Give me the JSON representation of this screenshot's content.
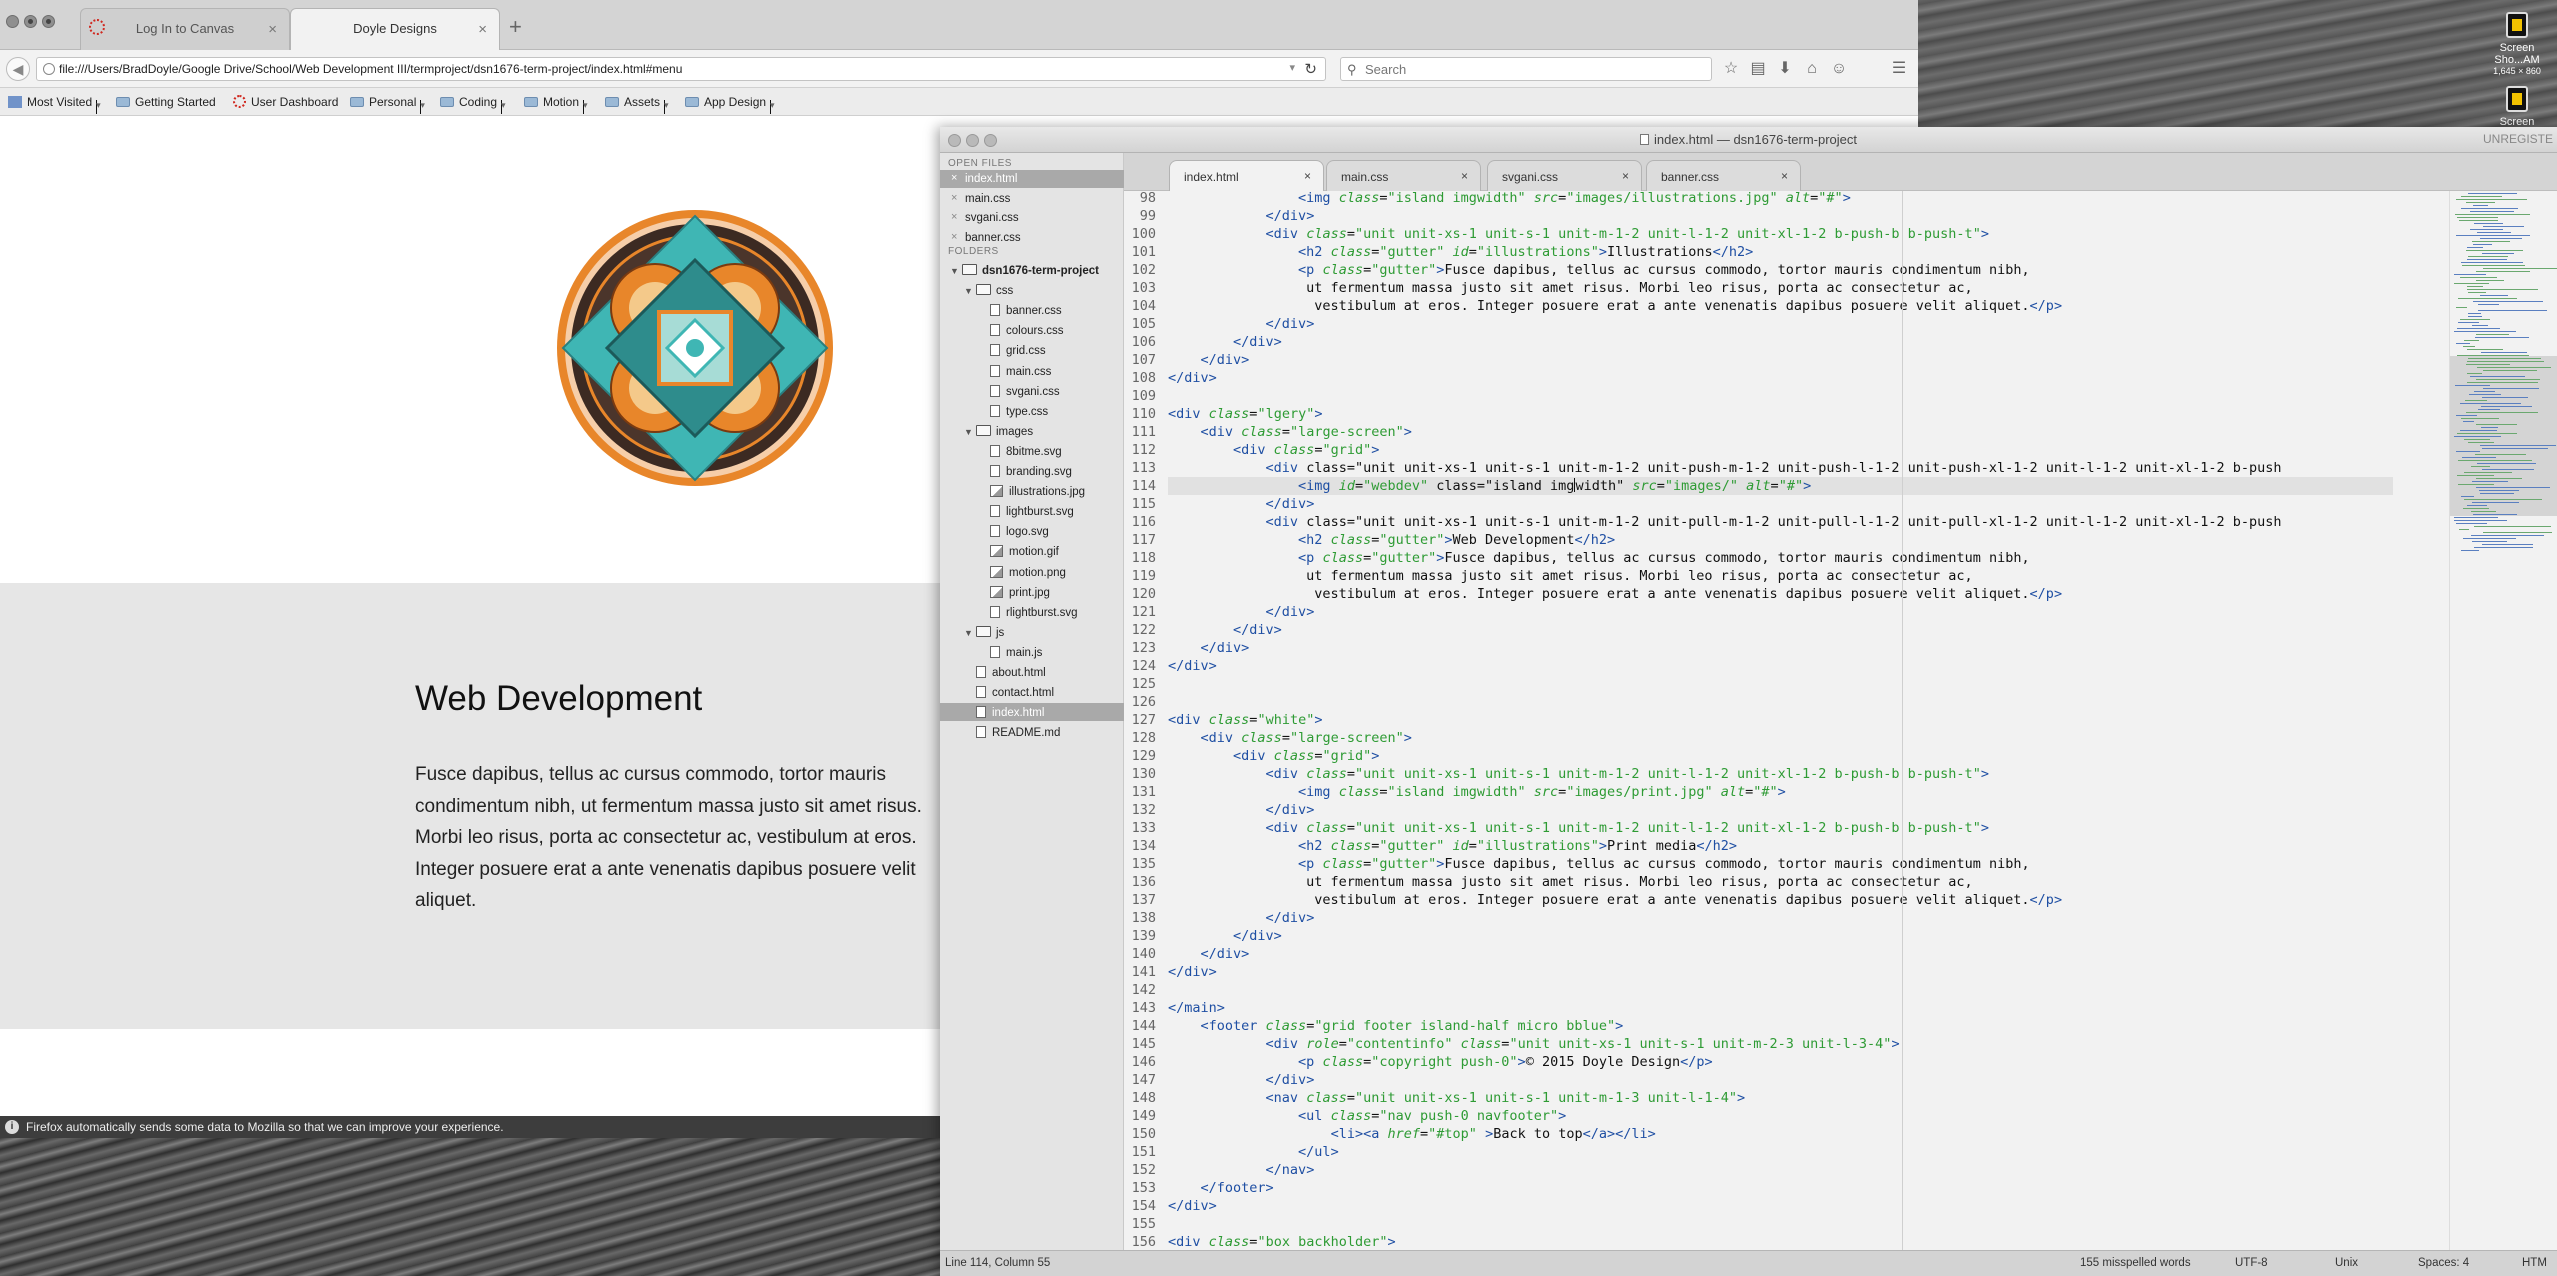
{
  "firefox": {
    "tabs": [
      {
        "label": "Log In to Canvas"
      },
      {
        "label": "Doyle Designs"
      }
    ],
    "url": "file:///Users/BradDoyle/Google Drive/School/Web Development III/termproject/dsn1676-term-project/index.html#menu",
    "search_placeholder": "Search",
    "bookmarks": [
      "Most Visited",
      "Getting Started",
      "User Dashboard",
      "Personal",
      "Coding",
      "Motion",
      "Assets",
      "App Design"
    ],
    "notification": "Firefox automatically sends some data to Mozilla so that we can improve your experience."
  },
  "page": {
    "heading": "Web Development",
    "body": "Fusce dapibus, tellus ac cursus commodo, tortor mauris condimentum nibh, ut fermentum massa justo sit amet risus. Morbi leo risus, porta ac consectetur ac, vestibulum at eros. Integer posuere erat a ante venenatis dapibus posuere velit aliquet."
  },
  "desktop": {
    "icons": [
      {
        "label": "Screen Sho...AM",
        "sub": "1,645 × 860"
      },
      {
        "label": "Screen",
        "sub": ""
      }
    ]
  },
  "editor": {
    "title": "index.html — dsn1676-term-project",
    "unregistered": "UNREGISTE",
    "sidebar": {
      "open_files_header": "OPEN FILES",
      "open_files": [
        "index.html",
        "main.css",
        "svgani.css",
        "banner.css"
      ],
      "folders_header": "FOLDERS",
      "tree": [
        {
          "label": "dsn1676-term-project",
          "kind": "folder",
          "depth": 0
        },
        {
          "label": "css",
          "kind": "folder",
          "depth": 1
        },
        {
          "label": "banner.css",
          "kind": "file",
          "depth": 2
        },
        {
          "label": "colours.css",
          "kind": "file",
          "depth": 2
        },
        {
          "label": "grid.css",
          "kind": "file",
          "depth": 2
        },
        {
          "label": "main.css",
          "kind": "file",
          "depth": 2
        },
        {
          "label": "svgani.css",
          "kind": "file",
          "depth": 2
        },
        {
          "label": "type.css",
          "kind": "file",
          "depth": 2
        },
        {
          "label": "images",
          "kind": "folder",
          "depth": 1
        },
        {
          "label": "8bitme.svg",
          "kind": "file",
          "depth": 2
        },
        {
          "label": "branding.svg",
          "kind": "file",
          "depth": 2
        },
        {
          "label": "illustrations.jpg",
          "kind": "img",
          "depth": 2
        },
        {
          "label": "lightburst.svg",
          "kind": "file",
          "depth": 2
        },
        {
          "label": "logo.svg",
          "kind": "file",
          "depth": 2
        },
        {
          "label": "motion.gif",
          "kind": "img",
          "depth": 2
        },
        {
          "label": "motion.png",
          "kind": "img",
          "depth": 2
        },
        {
          "label": "print.jpg",
          "kind": "img",
          "depth": 2
        },
        {
          "label": "rlightburst.svg",
          "kind": "file",
          "depth": 2
        },
        {
          "label": "js",
          "kind": "folder",
          "depth": 1
        },
        {
          "label": "main.js",
          "kind": "file",
          "depth": 2
        },
        {
          "label": "about.html",
          "kind": "file",
          "depth": 1
        },
        {
          "label": "contact.html",
          "kind": "file",
          "depth": 1
        },
        {
          "label": "index.html",
          "kind": "file",
          "depth": 1,
          "selected": true
        },
        {
          "label": "README.md",
          "kind": "file",
          "depth": 1
        }
      ]
    },
    "tabs": [
      "index.html",
      "main.css",
      "svgani.css",
      "banner.css"
    ],
    "current_line": 114,
    "code": [
      {
        "n": 98,
        "t": "                <img class=\"island imgwidth\" src=\"images/illustrations.jpg\" alt=\"#\">"
      },
      {
        "n": 99,
        "t": "            </div>"
      },
      {
        "n": 100,
        "t": "            <div class=\"unit unit-xs-1 unit-s-1 unit-m-1-2 unit-l-1-2 unit-xl-1-2 b-push-b b-push-t\">"
      },
      {
        "n": 101,
        "t": "                <h2 class=\"gutter\" id=\"illustrations\">Illustrations</h2>"
      },
      {
        "n": 102,
        "t": "                <p class=\"gutter\">Fusce dapibus, tellus ac cursus commodo, tortor mauris condimentum nibh,"
      },
      {
        "n": 103,
        "t": "                 ut fermentum massa justo sit amet risus. Morbi leo risus, porta ac consectetur ac,"
      },
      {
        "n": 104,
        "t": "                  vestibulum at eros. Integer posuere erat a ante venenatis dapibus posuere velit aliquet.</p>"
      },
      {
        "n": 105,
        "t": "            </div>"
      },
      {
        "n": 106,
        "t": "        </div>"
      },
      {
        "n": 107,
        "t": "    </div>"
      },
      {
        "n": 108,
        "t": "</div>"
      },
      {
        "n": 109,
        "t": ""
      },
      {
        "n": 110,
        "t": "<div class=\"lgery\">"
      },
      {
        "n": 111,
        "t": "    <div class=\"large-screen\">"
      },
      {
        "n": 112,
        "t": "        <div class=\"grid\">"
      },
      {
        "n": 113,
        "t": "            <div class=\"unit unit-xs-1 unit-s-1 unit-m-1-2 unit-push-m-1-2 unit-push-l-1-2 unit-push-xl-1-2 unit-l-1-2 unit-xl-1-2 b-push"
      },
      {
        "n": 114,
        "t": "                <img id=\"webdev\" class=\"island imgwidth\" src=\"images/\" alt=\"#\">"
      },
      {
        "n": 115,
        "t": "            </div>"
      },
      {
        "n": 116,
        "t": "            <div class=\"unit unit-xs-1 unit-s-1 unit-m-1-2 unit-pull-m-1-2 unit-pull-l-1-2 unit-pull-xl-1-2 unit-l-1-2 unit-xl-1-2 b-push"
      },
      {
        "n": 117,
        "t": "                <h2 class=\"gutter\">Web Development</h2>"
      },
      {
        "n": 118,
        "t": "                <p class=\"gutter\">Fusce dapibus, tellus ac cursus commodo, tortor mauris condimentum nibh,"
      },
      {
        "n": 119,
        "t": "                 ut fermentum massa justo sit amet risus. Morbi leo risus, porta ac consectetur ac,"
      },
      {
        "n": 120,
        "t": "                  vestibulum at eros. Integer posuere erat a ante venenatis dapibus posuere velit aliquet.</p>"
      },
      {
        "n": 121,
        "t": "            </div>"
      },
      {
        "n": 122,
        "t": "        </div>"
      },
      {
        "n": 123,
        "t": "    </div>"
      },
      {
        "n": 124,
        "t": "</div>"
      },
      {
        "n": 125,
        "t": ""
      },
      {
        "n": 126,
        "t": ""
      },
      {
        "n": 127,
        "t": "<div class=\"white\">"
      },
      {
        "n": 128,
        "t": "    <div class=\"large-screen\">"
      },
      {
        "n": 129,
        "t": "        <div class=\"grid\">"
      },
      {
        "n": 130,
        "t": "            <div class=\"unit unit-xs-1 unit-s-1 unit-m-1-2 unit-l-1-2 unit-xl-1-2 b-push-b b-push-t\">"
      },
      {
        "n": 131,
        "t": "                <img class=\"island imgwidth\" src=\"images/print.jpg\" alt=\"#\">"
      },
      {
        "n": 132,
        "t": "            </div>"
      },
      {
        "n": 133,
        "t": "            <div class=\"unit unit-xs-1 unit-s-1 unit-m-1-2 unit-l-1-2 unit-xl-1-2 b-push-b b-push-t\">"
      },
      {
        "n": 134,
        "t": "                <h2 class=\"gutter\" id=\"illustrations\">Print media</h2>"
      },
      {
        "n": 135,
        "t": "                <p class=\"gutter\">Fusce dapibus, tellus ac cursus commodo, tortor mauris condimentum nibh,"
      },
      {
        "n": 136,
        "t": "                 ut fermentum massa justo sit amet risus. Morbi leo risus, porta ac consectetur ac,"
      },
      {
        "n": 137,
        "t": "                  vestibulum at eros. Integer posuere erat a ante venenatis dapibus posuere velit aliquet.</p>"
      },
      {
        "n": 138,
        "t": "            </div>"
      },
      {
        "n": 139,
        "t": "        </div>"
      },
      {
        "n": 140,
        "t": "    </div>"
      },
      {
        "n": 141,
        "t": "</div>"
      },
      {
        "n": 142,
        "t": ""
      },
      {
        "n": 143,
        "t": "</main>"
      },
      {
        "n": 144,
        "t": "    <footer class=\"grid footer island-half micro bblue\">"
      },
      {
        "n": 145,
        "t": "            <div role=\"contentinfo\" class=\"unit unit-xs-1 unit-s-1 unit-m-2-3 unit-l-3-4\">"
      },
      {
        "n": 146,
        "t": "                <p class=\"copyright push-0\">© 2015 Doyle Design</p>"
      },
      {
        "n": 147,
        "t": "            </div>"
      },
      {
        "n": 148,
        "t": "            <nav class=\"unit unit-xs-1 unit-s-1 unit-m-1-3 unit-l-1-4\">"
      },
      {
        "n": 149,
        "t": "                <ul class=\"nav push-0 navfooter\">"
      },
      {
        "n": 150,
        "t": "                    <li><a href=\"#top\" >Back to top</a></li>"
      },
      {
        "n": 151,
        "t": "                </ul>"
      },
      {
        "n": 152,
        "t": "            </nav>"
      },
      {
        "n": 153,
        "t": "    </footer>"
      },
      {
        "n": 154,
        "t": "</div>"
      },
      {
        "n": 155,
        "t": ""
      },
      {
        "n": 156,
        "t": "<div class=\"box backholder\">"
      }
    ],
    "status": {
      "position": "Line 114, Column 55",
      "misspelled": "155 misspelled words",
      "encoding": "UTF-8",
      "line_endings": "Unix",
      "indent": "Spaces: 4",
      "syntax": "HTM"
    }
  }
}
